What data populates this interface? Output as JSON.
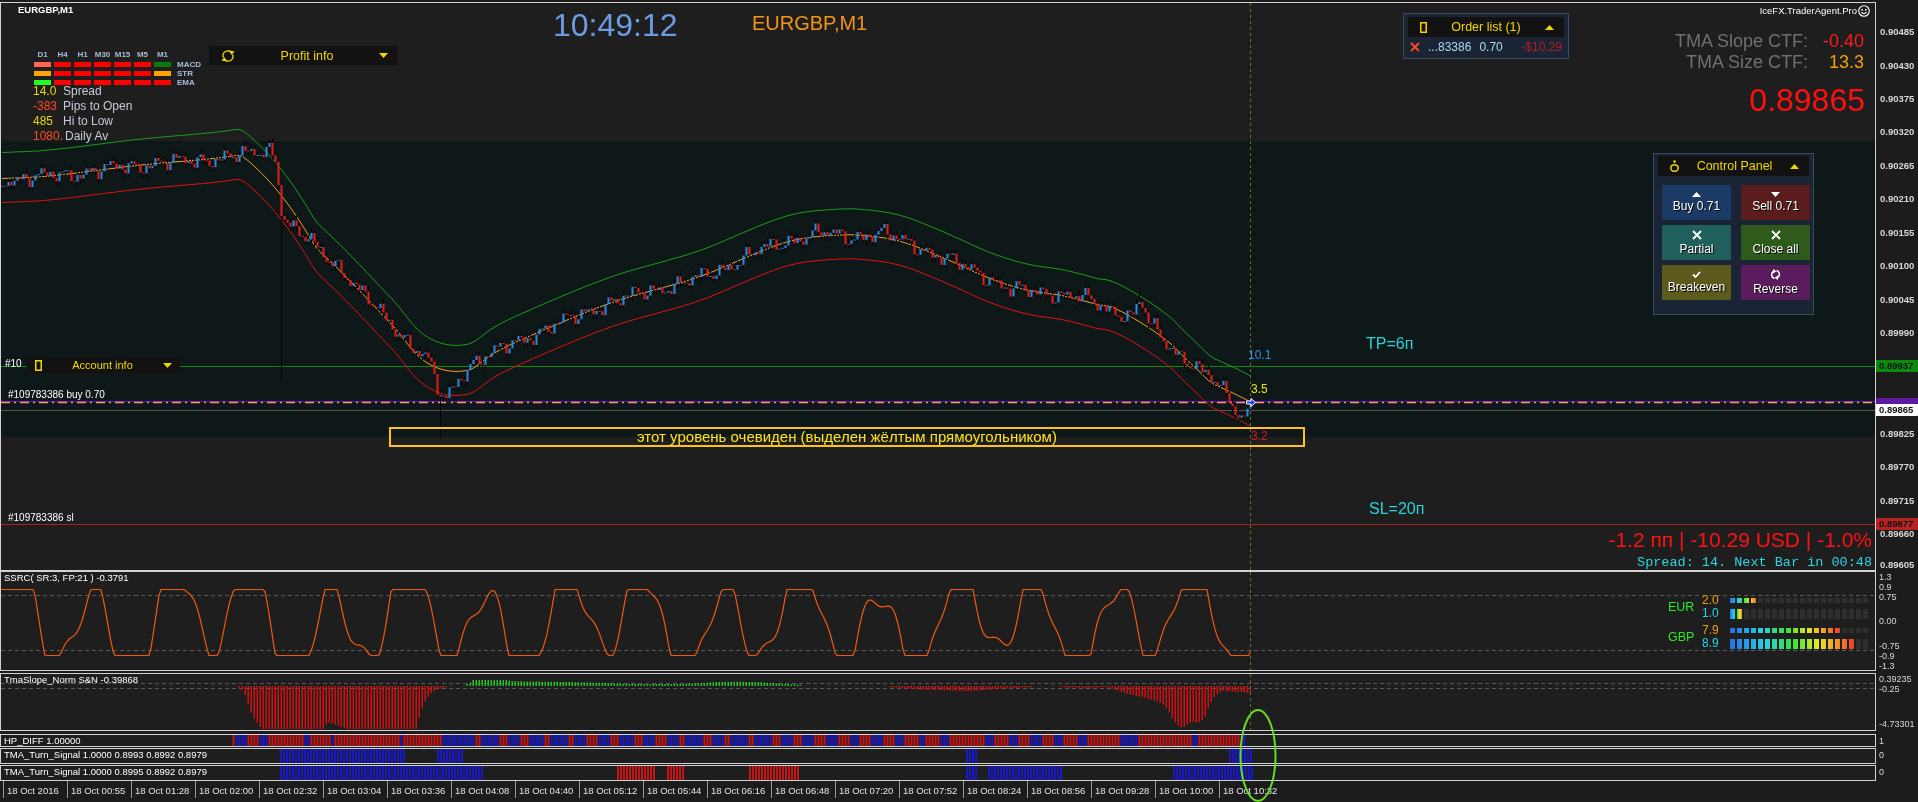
{
  "chart": {
    "symbol": "EURGBP,M1",
    "clock": "10:49:12",
    "title": "EURGBP,M1",
    "trend_matrix": {
      "timeframes": [
        "D1",
        "H4",
        "H1",
        "M30",
        "M15",
        "M5",
        "M1"
      ],
      "rows": [
        {
          "label": "MACD",
          "cells": [
            {
              "color": "#ff6652"
            },
            {
              "color": "#ff0000"
            },
            {
              "color": "#ff0000"
            },
            {
              "color": "#ff0000"
            },
            {
              "color": "#ff0000"
            },
            {
              "color": "#ff0000"
            },
            {
              "color": "#0a7a0a"
            }
          ]
        },
        {
          "label": "STR",
          "cells": [
            {
              "color": "#ffa500"
            },
            {
              "color": "#ff0000"
            },
            {
              "color": "#ff0000"
            },
            {
              "color": "#ff0000"
            },
            {
              "color": "#ff0000"
            },
            {
              "color": "#ff0000"
            },
            {
              "color": "#ffa500"
            }
          ]
        },
        {
          "label": "EMA",
          "cells": [
            {
              "color": "#22ff22"
            },
            {
              "color": "#ff0000"
            },
            {
              "color": "#ff0000"
            },
            {
              "color": "#ff0000"
            },
            {
              "color": "#ff0000"
            },
            {
              "color": "#ff0000"
            },
            {
              "color": "#ff0000"
            }
          ]
        }
      ]
    },
    "stats": [
      {
        "reading": "14.0",
        "metric": "Spread",
        "color": "#e8d800"
      },
      {
        "reading": "-383",
        "metric": "Pips to Open",
        "color": "#ff4a1e"
      },
      {
        "reading": "485",
        "metric": "Hi to Low",
        "color": "#e8d800"
      },
      {
        "reading": "1080.",
        "metric": "Daily Av",
        "color": "#ff4a1e"
      }
    ],
    "profit_info": {
      "title": "Profit info",
      "expanded": false
    },
    "order_list": {
      "title": "Order list (1)",
      "expanded": true,
      "orders": [
        {
          "ticket": "...83386",
          "lots": "0.70",
          "profit": "-$10.29"
        }
      ]
    },
    "brand": "IceFX.TraderAgent.Pro",
    "tma": [
      {
        "label": "TMA Slope CTF:",
        "value": "-0.40",
        "color": "#ff1a1a"
      },
      {
        "label": "TMA Size CTF:",
        "value": "13.3",
        "color": "#f0a000"
      }
    ],
    "price": "0.89865",
    "control_panel": {
      "title": "Control Panel",
      "expanded": true,
      "buttons": [
        {
          "kind": "buy",
          "label": "Buy 0.71"
        },
        {
          "kind": "sell",
          "label": "Sell 0.71"
        },
        {
          "kind": "partial",
          "label": "Partial"
        },
        {
          "kind": "close_all",
          "label": "Close all"
        },
        {
          "kind": "breakeven",
          "label": "Breakeven"
        },
        {
          "kind": "reverse",
          "label": "Reverse"
        }
      ]
    },
    "account_info": {
      "title": "Account info",
      "expanded": false
    },
    "order_labels": [
      {
        "kind": "tp",
        "text": "#10"
      },
      {
        "kind": "open",
        "text": "#109783386 buy 0.70"
      },
      {
        "kind": "sl",
        "text": "#109783386 sl"
      }
    ],
    "levels": [
      {
        "kind": "tp",
        "text": "TP=6п"
      },
      {
        "kind": "sl",
        "text": "SL=20п"
      }
    ],
    "markers": [
      {
        "kind": "upper",
        "text": "10.1"
      },
      {
        "kind": "middle",
        "text": "3.5"
      },
      {
        "kind": "lower",
        "text": "3.2"
      }
    ],
    "annotation": "этот уровень очевиден (выделен жёлтым прямоугольником)",
    "result": "-1.2 пп | -10.29 USD | -1.0%",
    "timer": "Spread: 14. Next Bar in 00:48"
  },
  "price_axis": {
    "ticks": [
      "0.90485",
      "0.90430",
      "0.90375",
      "0.90320",
      "0.90265",
      "0.90210",
      "0.90155",
      "0.90100",
      "0.90045",
      "0.89990",
      "0.89825",
      "0.89770",
      "0.89715",
      "0.89660",
      "0.89605"
    ],
    "tags": [
      {
        "text": "0.89937",
        "color": "#0c8c0c"
      },
      {
        "text": "0.89865",
        "color": "#ffffff"
      },
      {
        "text": "0.89677",
        "color": "#b52323"
      }
    ]
  },
  "indicators": [
    {
      "kind": "oscillator",
      "title": "SSRC( SR:3, FP:21 ) -0.3791",
      "axis": [
        "1.3",
        "0.9",
        "0.75",
        "0.00",
        "-0.75",
        "-0.9",
        "-1.3"
      ],
      "strength": [
        {
          "currency": "EUR",
          "readings": [
            {
              "value": "2.0",
              "level": 0.2
            },
            {
              "value": "1.0",
              "level": 0.1
            }
          ]
        },
        {
          "currency": "GBP",
          "readings": [
            {
              "value": "7.9",
              "level": 0.8
            },
            {
              "value": "8.9",
              "level": 0.9
            }
          ]
        }
      ]
    },
    {
      "kind": "histogram",
      "title": "TmaSlope_Norm S&N -0.39868",
      "axis": [
        "0.39235",
        "-0.25",
        "-4.73301"
      ]
    },
    {
      "kind": "band",
      "title": "HP_DIFF 1.00000",
      "axis": [
        "1"
      ]
    },
    {
      "kind": "signal",
      "title": "TMA_Turn_Signal 1.0000 0.8993 0.8992 0.8979",
      "axis": [
        "0"
      ]
    },
    {
      "kind": "signal",
      "title": "TMA_Turn_Signal 1.0000 0.8995 0.8992 0.8979",
      "axis": [
        "0"
      ]
    }
  ],
  "time_axis": [
    "18 Oct 2016",
    "18 Oct 00:55",
    "18 Oct 01:28",
    "18 Oct 02:00",
    "18 Oct 02:32",
    "18 Oct 03:04",
    "18 Oct 03:36",
    "18 Oct 04:08",
    "18 Oct 04:40",
    "18 Oct 05:12",
    "18 Oct 05:44",
    "18 Oct 06:16",
    "18 Oct 06:48",
    "18 Oct 07:20",
    "18 Oct 07:52",
    "18 Oct 08:24",
    "18 Oct 08:56",
    "18 Oct 09:28",
    "18 Oct 10:00",
    "18 Oct 10:32"
  ]
}
